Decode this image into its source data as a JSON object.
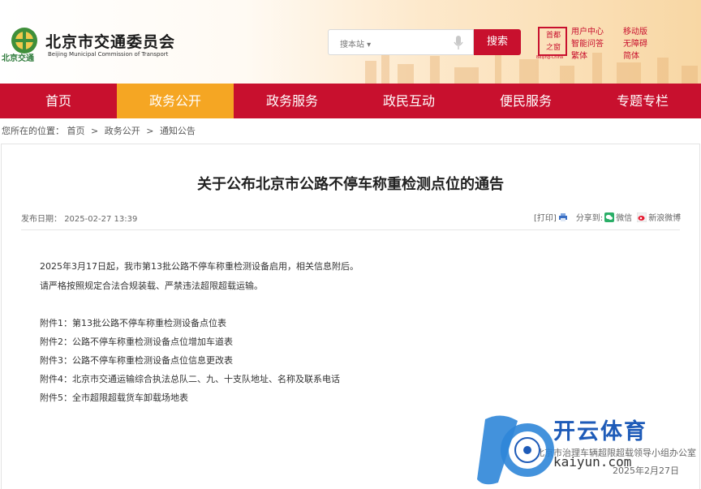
{
  "header": {
    "logo_small": "北京交通",
    "org_name_cn": "北京市交通委员会",
    "org_name_en": "Beijing Municipal Commission of Transport",
    "search": {
      "scope": "搜本站 ▾",
      "button": "搜索"
    },
    "seal": {
      "line1": "首都",
      "line2": "之窗",
      "en": "Beijing-China"
    },
    "links": [
      "用户中心",
      "移动版",
      "智能问答",
      "无障碍",
      "繁体",
      "简体"
    ]
  },
  "nav": {
    "items": [
      "首页",
      "政务公开",
      "政务服务",
      "政民互动",
      "便民服务",
      "专题专栏"
    ],
    "active_index": 1
  },
  "breadcrumb": {
    "prefix": "您所在的位置：",
    "items": [
      "首页",
      "政务公开",
      "通知公告"
    ]
  },
  "article": {
    "title": "关于公布北京市公路不停车称重检测点位的通告",
    "date_label": "发布日期：",
    "date": "2025-02-27 13:39",
    "print": "[打印]",
    "share_label": "分享到:",
    "share_wechat": "微信",
    "share_weibo": "新浪微博",
    "paragraphs": [
      "2025年3月17日起，我市第13批公路不停车称重检测设备启用，相关信息附后。",
      "请严格按照规定合法合规装载、严禁违法超限超载运输。"
    ],
    "attachments": [
      "附件1：第13批公路不停车称重检测设备点位表",
      "附件2：公路不停车称重检测设备点位增加车道表",
      "附件3：公路不停车称重检测设备点位信息更改表",
      "附件4：北京市交通运输综合执法总队二、九、十支队地址、名称及联系电话",
      "附件5：全市超限超载货车卸载场地表"
    ],
    "signature": "北京市治理车辆超限超载领导小组办公室",
    "signature_date": "2025年2月27日"
  },
  "watermark": {
    "name": "开云体育",
    "url": "kaiyun.com"
  },
  "colors": {
    "brand_red": "#c8102e",
    "active_orange": "#f5a623",
    "watermark_blue": "#1e5bb8"
  }
}
